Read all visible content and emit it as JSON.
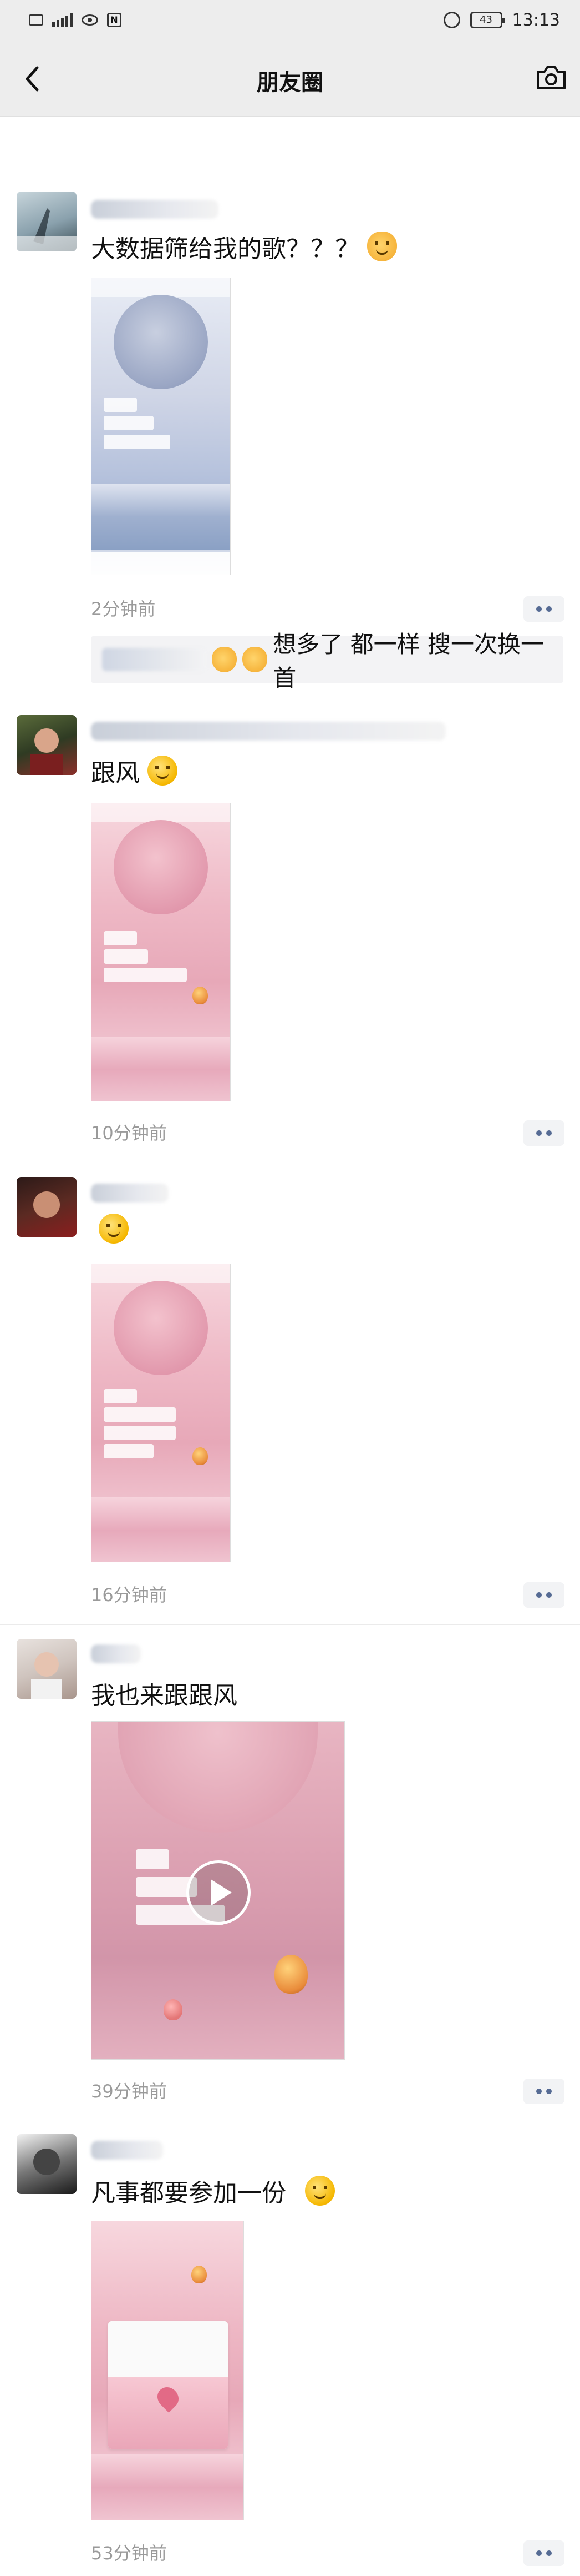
{
  "status_bar": {
    "battery": "43",
    "clock": "13:13"
  },
  "nav": {
    "title": "朋友圈",
    "back_icon": "chevron-left-icon",
    "camera_icon": "camera-icon"
  },
  "posts": [
    {
      "text": "大数据筛给我的歌？？？",
      "emoji": "cat-face",
      "time": "2分钟前",
      "comment": "想多了 都一样 搜一次换一首"
    },
    {
      "text": "跟风",
      "emoji": "thinking-face",
      "time": "10分钟前"
    },
    {
      "text": "",
      "emoji": "flushed-face",
      "time": "16分钟前"
    },
    {
      "text": "我也来跟跟风",
      "time": "39分钟前"
    },
    {
      "text": "凡事都要参加一份",
      "emoji": "thinking-face",
      "time": "53分钟前"
    }
  ]
}
